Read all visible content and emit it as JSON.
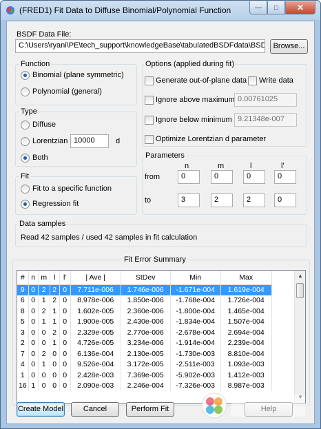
{
  "window": {
    "title": "(FRED1) Fit Data to Diffuse Binomial/Polynomial Function",
    "min_glyph": "—",
    "max_glyph": "□",
    "close_glyph": "✕"
  },
  "bsdf": {
    "label": "BSDF Data File:",
    "path": "C:\\Users\\ryani\\PE\\tech_support\\knowledgeBase\\tabulatedBSDFdata\\BSDATA",
    "browse_label": "Browse..."
  },
  "function_group": {
    "title": "Function",
    "options": [
      {
        "label": "Binomial (plane symmetric)",
        "selected": true
      },
      {
        "label": "Polynomial (general)",
        "selected": false
      }
    ]
  },
  "type_group": {
    "title": "Type",
    "diffuse_label": "Diffuse",
    "lorentzian_label": "Lorentzian",
    "lorentzian_value": "10000",
    "lorentzian_unit": "d",
    "both_label": "Both",
    "selected": "Both"
  },
  "fit_group": {
    "title": "Fit",
    "options": [
      {
        "label": "Fit to a specific function",
        "selected": false
      },
      {
        "label": "Regression fit",
        "selected": true
      }
    ]
  },
  "options_group": {
    "title": "Options (applied during fit)",
    "generate_out_of_plane": "Generate out-of-plane data",
    "write_data": "Write data",
    "ignore_above_label": "Ignore above maximum",
    "ignore_above_value": "0.00761025",
    "ignore_below_label": "Ignore below minimum",
    "ignore_below_value": "9.21348e-007",
    "optimize_lorentzian": "Optimize Lorentzian d parameter"
  },
  "parameters_group": {
    "title": "Parameters",
    "columns": [
      "n",
      "m",
      "l",
      "l'"
    ],
    "from_label": "from",
    "to_label": "to",
    "from_values": [
      "0",
      "0",
      "0",
      "0"
    ],
    "to_values": [
      "3",
      "2",
      "2",
      "0"
    ]
  },
  "samples_group": {
    "title": "Data samples",
    "message": "Read 42 samples / used 42 samples in fit calculation"
  },
  "fit_summary": {
    "title": "Fit Error Summary",
    "columns": [
      "#",
      "n",
      "m",
      "l",
      "l'",
      "| Ave |",
      "StDev",
      "Min",
      "Max"
    ],
    "rows": [
      [
        "9",
        "0",
        "2",
        "2",
        "0",
        "7.711e-006",
        "1.746e-006",
        "-1.671e-004",
        "1.619e-004"
      ],
      [
        "6",
        "0",
        "1",
        "2",
        "0",
        "8.978e-006",
        "1.850e-006",
        "-1.768e-004",
        "1.726e-004"
      ],
      [
        "8",
        "0",
        "2",
        "1",
        "0",
        "1.602e-005",
        "2.360e-006",
        "-1.800e-004",
        "1.465e-004"
      ],
      [
        "5",
        "0",
        "1",
        "1",
        "0",
        "1.900e-005",
        "2.430e-006",
        "-1.834e-004",
        "1.507e-004"
      ],
      [
        "3",
        "0",
        "0",
        "2",
        "0",
        "2.329e-005",
        "2.770e-006",
        "-2.678e-004",
        "2.694e-004"
      ],
      [
        "2",
        "0",
        "0",
        "1",
        "0",
        "4.726e-005",
        "3.234e-006",
        "-1.914e-004",
        "2.239e-004"
      ],
      [
        "7",
        "0",
        "2",
        "0",
        "0",
        "6.136e-004",
        "2.130e-005",
        "-1.730e-003",
        "8.810e-004"
      ],
      [
        "4",
        "0",
        "1",
        "0",
        "0",
        "9.526e-004",
        "3.172e-005",
        "-2.511e-003",
        "1.093e-003"
      ],
      [
        "1",
        "0",
        "0",
        "0",
        "0",
        "2.428e-003",
        "7.369e-005",
        "-5.902e-003",
        "1.412e-003"
      ],
      [
        "16",
        "1",
        "0",
        "0",
        "0",
        "2.090e-003",
        "2.246e-004",
        "-7.326e-003",
        "8.987e-003"
      ]
    ]
  },
  "buttons": {
    "create_model": "Create Model",
    "cancel": "Cancel",
    "perform_fit": "Perform Fit",
    "help": "Help"
  },
  "colors": {
    "selection": "#3399ff",
    "title_bar": "#b6d0ea",
    "close_button": "#c7452f"
  }
}
